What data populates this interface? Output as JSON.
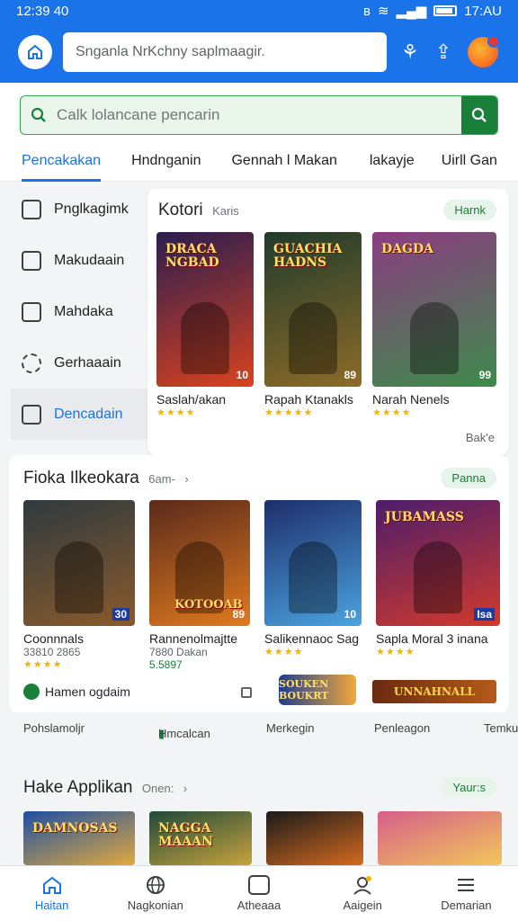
{
  "status_bar": {
    "time": "12:39 40",
    "right_text": "17:AU"
  },
  "app_bar": {
    "search_text": "Snganla NrKchny saplmaagir."
  },
  "search": {
    "placeholder": "Calk lolancane pencarin"
  },
  "tabs": [
    {
      "label": "Pencakakan",
      "active": true
    },
    {
      "label": "Hndnganin"
    },
    {
      "label": "Gennah l Makan"
    },
    {
      "label": "lakayje"
    },
    {
      "label": "Uirll Gan"
    }
  ],
  "sidebar": {
    "items": [
      {
        "label": "Pnglkagimk",
        "icon": "briefcase-icon"
      },
      {
        "label": "Makudaain",
        "icon": "image-icon"
      },
      {
        "label": "Mahdaka",
        "icon": "grid-icon"
      },
      {
        "label": "Gerhaaain",
        "icon": "gear-icon"
      },
      {
        "label": "Dencadain",
        "icon": "document-icon",
        "active": true
      }
    ]
  },
  "featured": {
    "title": "Kotori",
    "subtitle": "Karis",
    "pill": "Harnk",
    "more": "Bak'e",
    "cards": [
      {
        "name": "Saslah/akan",
        "badge": "10",
        "art": "DRACA NGBAD",
        "stars": "★★★★",
        "colors": [
          "#2b1d4f",
          "#d8431f"
        ]
      },
      {
        "name": "Rapah Ktanakls",
        "badge": "89",
        "art": "GUACHIA HADNS",
        "stars": "★★★★★",
        "colors": [
          "#1f3b2c",
          "#8d6b28"
        ]
      },
      {
        "name": "Narah Nenels",
        "badge": "99",
        "art": "DAGDA",
        "stars": "★★★★",
        "colors": [
          "#8c3c82",
          "#3d8b4a"
        ]
      }
    ]
  },
  "section2": {
    "title": "Fioka Ilkeokara",
    "subtitle": "6am-",
    "pill": "Panna",
    "cards": [
      {
        "name": "Coonnnals",
        "meta": "33810 2865",
        "badge": "30",
        "stars": "★★★★",
        "art": "",
        "colors": [
          "#2e3a3f",
          "#8a5a2b"
        ]
      },
      {
        "name": "Rannenolmajtte",
        "meta": "7880 Dakan",
        "price": "5.5897",
        "badge": "89",
        "art": "KOTOOAB",
        "stars": "",
        "colors": [
          "#5a2a1b",
          "#e07a1f"
        ]
      },
      {
        "name": "Salikennaoc Sag",
        "meta": "",
        "badge": "10",
        "art": "",
        "stars": "★★★★",
        "colors": [
          "#1e2e6b",
          "#4aa3df"
        ]
      },
      {
        "name": "Sapla Moral 3 inana",
        "meta": "",
        "badge": "Isa",
        "art": "JUBAMASS",
        "stars": "★★★★",
        "colors": [
          "#4b1d6b",
          "#d23a2b"
        ]
      }
    ],
    "footer_text": "Hamen ogdaim",
    "banner1": "SOUKEN BOUKRT",
    "banner2": "UNNAHNALL"
  },
  "mini_tags": [
    "Pohslamoljr",
    "Hmcalcan",
    "Merkegin",
    "Penleagon",
    "Temku"
  ],
  "section3": {
    "title": "Hake Applikan",
    "subtitle": "Onen:",
    "pill": "Yaur:s",
    "cards": [
      {
        "art": "DAMNOSAS",
        "colors": [
          "#1e4fa3",
          "#e0a93f"
        ]
      },
      {
        "art": "NAGGA MAAAN",
        "colors": [
          "#1f4a3a",
          "#c8a23c"
        ]
      },
      {
        "art": "",
        "colors": [
          "#1a1a1a",
          "#d46a1f"
        ]
      },
      {
        "art": "",
        "colors": [
          "#d65f8a",
          "#f2c65a"
        ]
      }
    ]
  },
  "bottom_nav": [
    {
      "label": "Haitan",
      "icon": "home-icon",
      "active": true
    },
    {
      "label": "Nagkonian",
      "icon": "globe-icon"
    },
    {
      "label": "Atheaaa",
      "icon": "calculator-icon"
    },
    {
      "label": "Aaigein",
      "icon": "profile-icon"
    },
    {
      "label": "Demarian",
      "icon": "menu-icon"
    }
  ],
  "colors": {
    "primary": "#1a73e8",
    "green": "#188038",
    "star": "#f4b400"
  }
}
